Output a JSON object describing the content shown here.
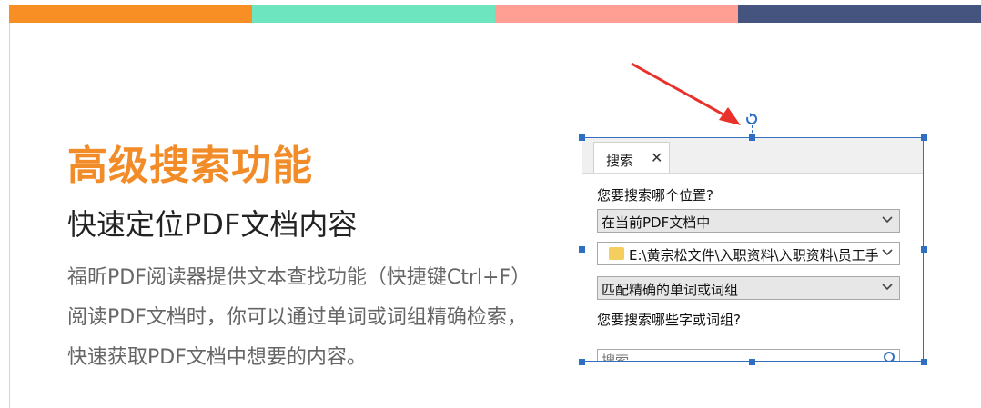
{
  "colors": {
    "bar": [
      "#f88f24",
      "#6de6c0",
      "#ff9e93",
      "#45537f"
    ],
    "accent": "#f28c28",
    "selection": "#3570c0",
    "arrow": "#e8312a"
  },
  "hero": {
    "title": "高级搜索功能",
    "subtitle": "快速定位PDF文档内容",
    "description": [
      "福昕PDF阅读器提供文本查找功能（快捷键Ctrl+F）",
      "阅读PDF文档时，你可以通过单词或词组精确检索，",
      "快速获取PDF文档中想要的内容。"
    ]
  },
  "search_panel": {
    "tab_label": "搜索",
    "close_glyph": "✕",
    "where_label": "您要搜索哪个位置?",
    "scope_value": "在当前PDF文档中",
    "path_value": "E:\\黄宗松文件\\入职资料\\入职资料\\员工手册",
    "match_value": "匹配精确的单词或词组",
    "what_label": "您要搜索哪些字或词组?",
    "search_placeholder": "搜索"
  },
  "icons": {
    "rotate": "rotate-handle-icon",
    "folder": "folder-icon",
    "chevron": "chevron-down-icon",
    "search": "search-icon",
    "close": "close-icon",
    "arrow": "red-arrow-icon"
  }
}
